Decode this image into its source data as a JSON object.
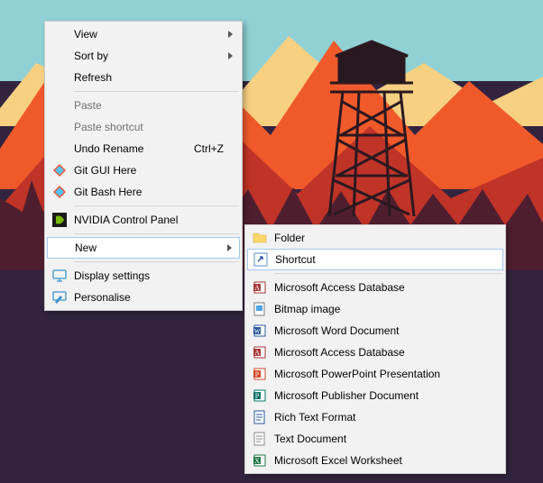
{
  "main_menu": {
    "view": "View",
    "sort_by": "Sort by",
    "refresh": "Refresh",
    "paste": "Paste",
    "paste_shortcut": "Paste shortcut",
    "undo_rename": "Undo Rename",
    "undo_rename_shortcut": "Ctrl+Z",
    "git_gui": "Git GUI Here",
    "git_bash": "Git Bash Here",
    "nvidia": "NVIDIA Control Panel",
    "new": "New",
    "display_settings": "Display settings",
    "personalise": "Personalise"
  },
  "new_submenu": {
    "folder": "Folder",
    "shortcut": "Shortcut",
    "access1": "Microsoft Access Database",
    "bitmap": "Bitmap image",
    "word": "Microsoft Word Document",
    "access2": "Microsoft Access Database",
    "powerpoint": "Microsoft PowerPoint Presentation",
    "publisher": "Microsoft Publisher Document",
    "rtf": "Rich Text Format",
    "text": "Text Document",
    "excel": "Microsoft Excel Worksheet"
  }
}
